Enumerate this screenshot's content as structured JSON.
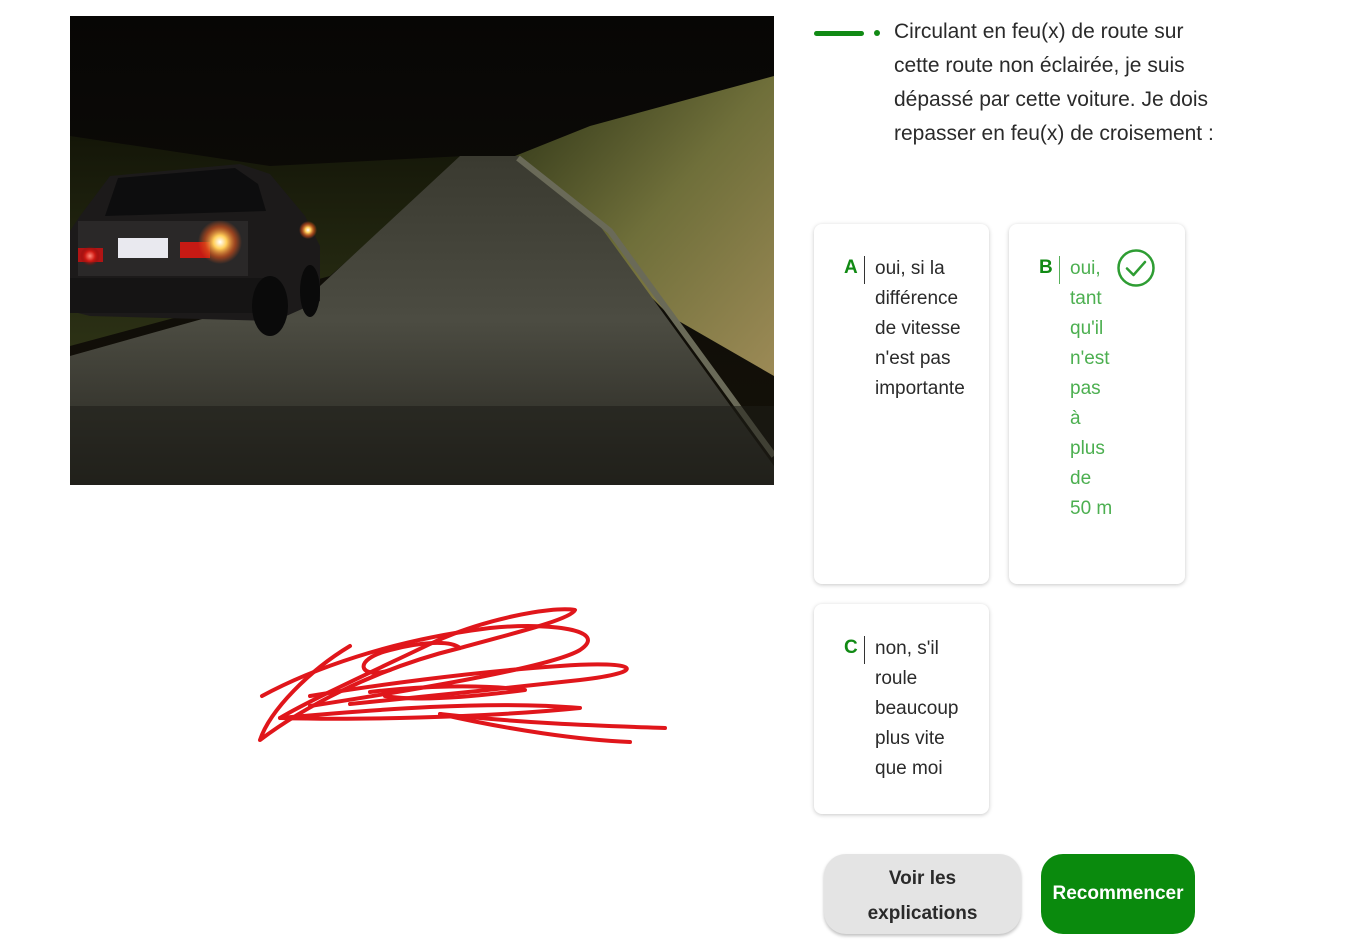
{
  "photo": {
    "icon": "night-road-overtaking-car-photo"
  },
  "annotation": {
    "icon": "red-scribble-signature",
    "color": "#e0161b"
  },
  "progress": {
    "color": "#118a14"
  },
  "question": {
    "text": "Circulant en feu(x) de route sur cette route non éclairée, je suis dépassé par cette voiture. Je dois repasser en feu(x) de croisement :"
  },
  "answers": [
    {
      "letter": "A",
      "text": "oui, si la différence de vitesse n'est pas importante",
      "correct": false
    },
    {
      "letter": "B",
      "text": "oui, tant qu'il n'est pas à plus de 50 m",
      "correct": true,
      "icon": "check-circle-icon"
    },
    {
      "letter": "C",
      "text": "non, s'il roule beaucoup plus vite que moi",
      "correct": false
    }
  ],
  "buttons": {
    "explain_label": "Voir les explications",
    "restart_label": "Recommencer"
  },
  "colors": {
    "accent": "#118a14",
    "correct_text": "#4caf50",
    "restart_button": "#0a8a0d",
    "secondary_button": "#e4e4e4"
  }
}
